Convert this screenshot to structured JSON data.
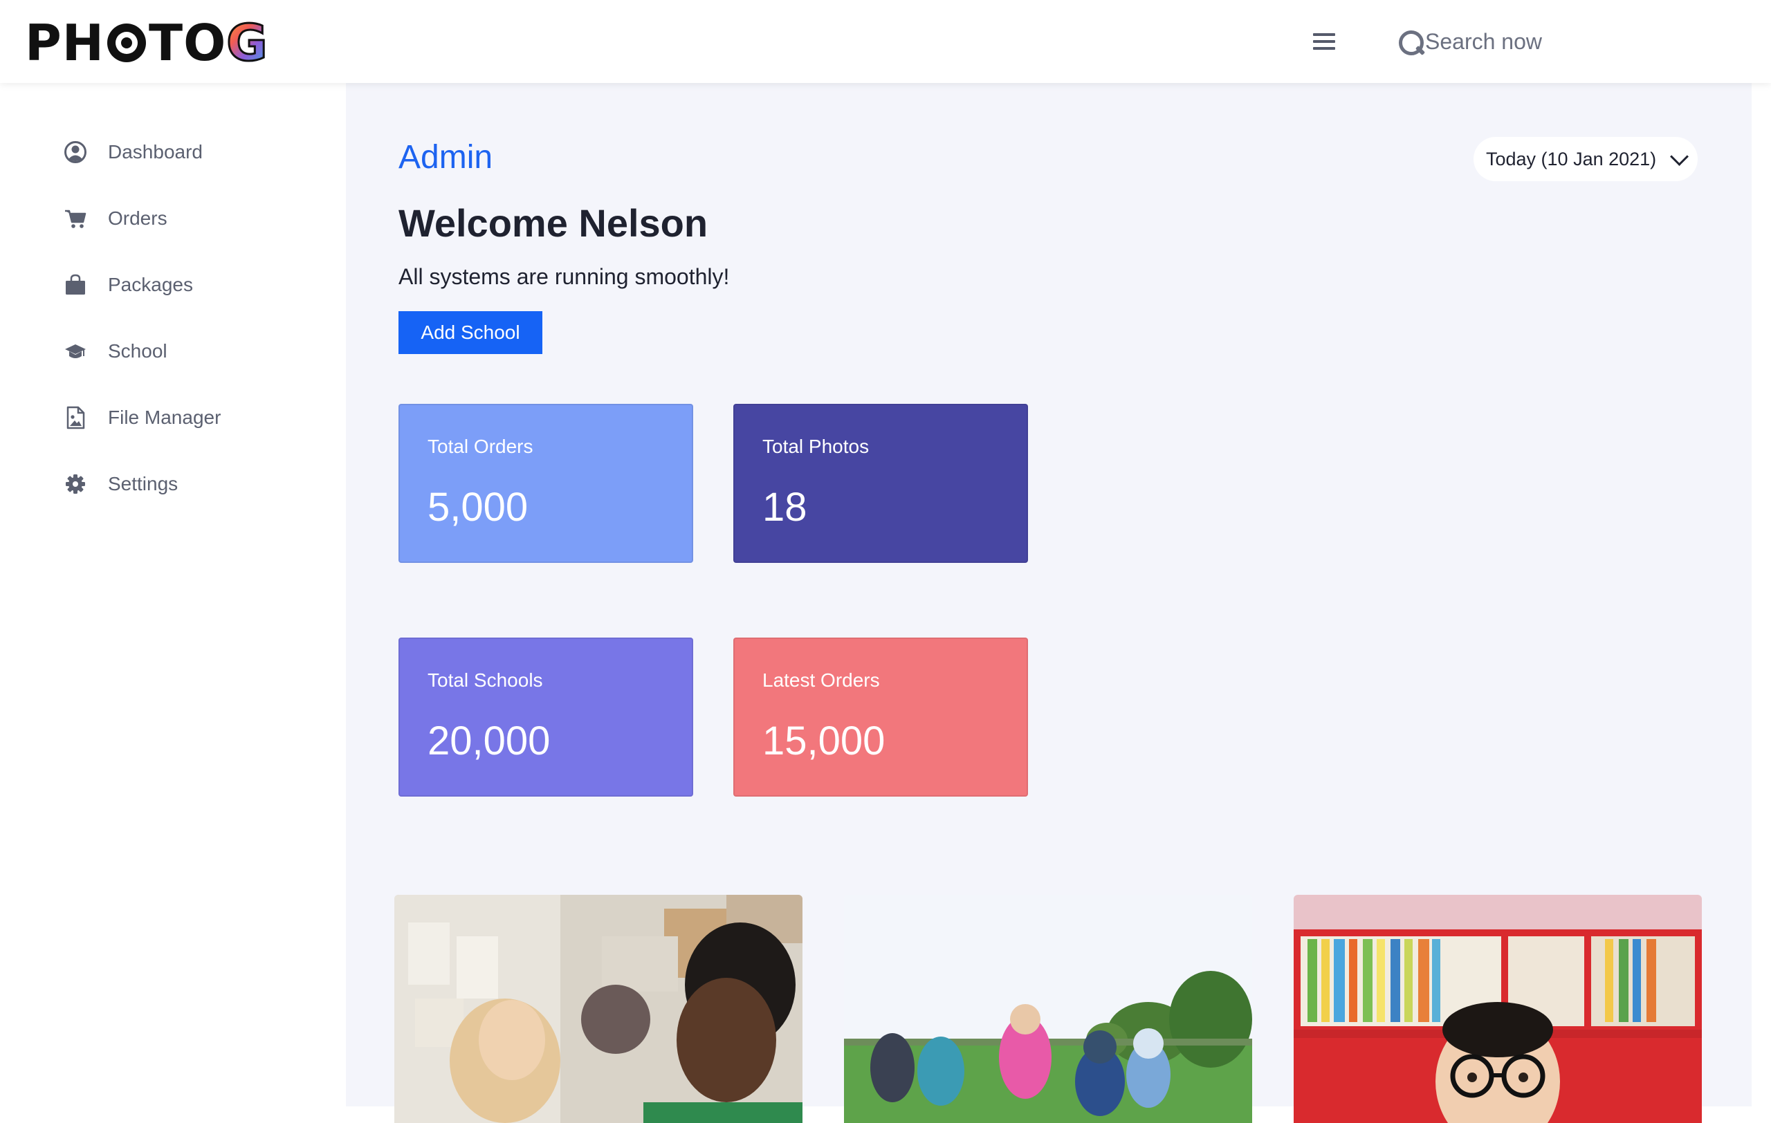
{
  "header": {
    "logo_text": "PHOTOG",
    "search_placeholder": "Search now",
    "icons": {
      "menu": "hamburger-menu-icon",
      "search": "search-icon"
    }
  },
  "sidebar": {
    "items": [
      {
        "label": "Dashboard",
        "icon": "user-circle-icon"
      },
      {
        "label": "Orders",
        "icon": "cart-icon"
      },
      {
        "label": "Packages",
        "icon": "shopping-bag-icon"
      },
      {
        "label": "School",
        "icon": "graduation-cap-icon"
      },
      {
        "label": "File Manager",
        "icon": "image-file-icon"
      },
      {
        "label": "Settings",
        "icon": "gear-icon"
      }
    ]
  },
  "main": {
    "title": "Admin",
    "date_selector": "Today (10 Jan 2021)",
    "welcome": "Welcome Nelson",
    "status": "All systems are running smoothly!",
    "add_button": "Add School",
    "stats": [
      {
        "label": "Total Orders",
        "value": "5,000",
        "color": "#7c9ef8"
      },
      {
        "label": "Total Photos",
        "value": "18",
        "color": "#4746a2"
      },
      {
        "label": "Total Schools",
        "value": "20,000",
        "color": "#7876e7"
      },
      {
        "label": "Latest Orders",
        "value": "15,000",
        "color": "#f2777c"
      }
    ],
    "photos": [
      {
        "subject": "children-in-classroom-photo"
      },
      {
        "subject": "children-playing-on-field-photo"
      },
      {
        "subject": "child-with-glasses-bookshelf-photo"
      }
    ]
  },
  "colors": {
    "accent": "#1d63f0",
    "button": "#1663f5",
    "main_bg": "#f4f5fb",
    "nav_text": "#5b6070"
  }
}
